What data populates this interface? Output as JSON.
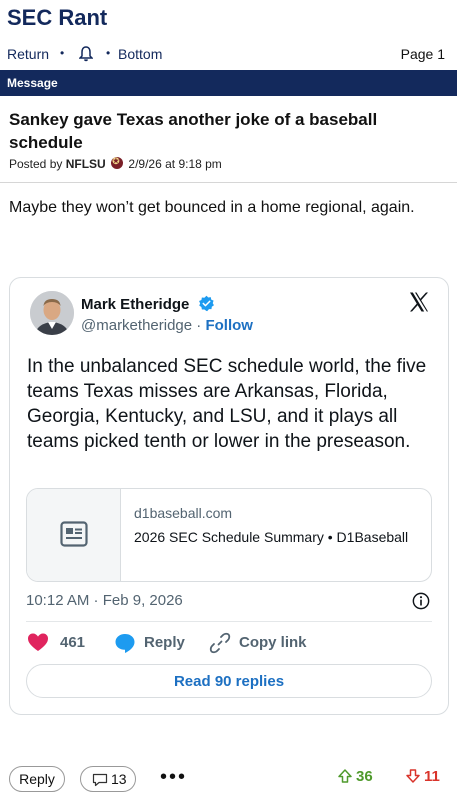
{
  "site": {
    "title": "SEC Rant"
  },
  "nav": {
    "return_label": "Return",
    "dot": "•",
    "bottom_label": "Bottom",
    "page_label": "Page 1"
  },
  "message_bar": {
    "label": "Message"
  },
  "post": {
    "title": "Sankey gave Texas another joke of a baseball schedule",
    "posted_by_prefix": "Posted by",
    "author": "NFLSU",
    "datetime": "2/9/26 at 9:18 pm",
    "body": "Maybe they won’t get bounced in a home regional, again."
  },
  "tweet": {
    "author_name": "Mark Etheridge",
    "handle": "@marketheridge",
    "separator": "·",
    "follow_label": "Follow",
    "text": "In the unbalanced SEC schedule world, the five teams Texas misses are Arkansas, Florida, Georgia, Kentucky, and LSU, and it plays all teams picked tenth or lower in the preseason.",
    "card": {
      "domain": "d1baseball.com",
      "title": "2026 SEC Schedule Summary • D1Baseball"
    },
    "timestamp": "10:12 AM · Feb 9, 2026",
    "likes": "461",
    "reply_label": "Reply",
    "copy_link_label": "Copy link",
    "read_replies_label": "Read 90 replies",
    "colors": {
      "accent": "#1d70c2",
      "like": "#e0245e",
      "verified": "#1d9bf0"
    }
  },
  "footer": {
    "reply_label": "Reply",
    "comment_count": "13",
    "more": "•••",
    "upvotes": "36",
    "downvotes": "11"
  },
  "colors": {
    "brand_navy": "#13295c",
    "up": "#4f9a2c",
    "down": "#d9342b"
  }
}
